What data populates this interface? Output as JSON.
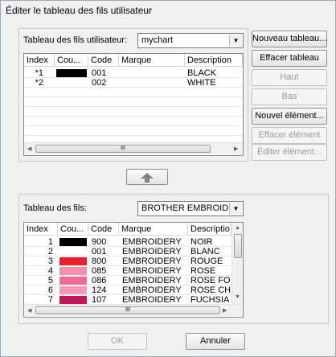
{
  "window": {
    "title": "Éditer le tableau des fils utilisateur"
  },
  "user_panel": {
    "label": "Tableau des fils utilisateur:",
    "chart_value": "mychart",
    "columns": [
      "Index",
      "Cou...",
      "Code",
      "Marque",
      "Description"
    ],
    "rows": [
      {
        "index": "*1",
        "color": "#000000",
        "code": "001",
        "brand": "",
        "description": "BLACK"
      },
      {
        "index": "*2",
        "color": "#ffffff",
        "code": "002",
        "brand": "",
        "description": "WHITE"
      }
    ],
    "scroll_thumb_glyph": "III",
    "buttons": {
      "new_chart": "Nouveau tableau...",
      "delete_chart": "Effacer tableau",
      "up": "Haut",
      "down": "Bas",
      "new_item": "Nouvel élément...",
      "delete_item": "Effacer élément",
      "edit_item": "Éditer élément..."
    }
  },
  "thread_panel": {
    "label": "Tableau des fils:",
    "chart_value": "BROTHER EMBROIDEF",
    "columns": [
      "Index",
      "Cou...",
      "Code",
      "Marque",
      "Descriptio"
    ],
    "rows": [
      {
        "index": "1",
        "color": "#000000",
        "code": "900",
        "brand": "EMBROIDERY",
        "description": "NOIR"
      },
      {
        "index": "2",
        "color": "#ffffff",
        "code": "001",
        "brand": "EMBROIDERY",
        "description": "BLANC"
      },
      {
        "index": "3",
        "color": "#e8202e",
        "code": "800",
        "brand": "EMBROIDERY",
        "description": "ROUGE"
      },
      {
        "index": "4",
        "color": "#f48fb0",
        "code": "085",
        "brand": "EMBROIDERY",
        "description": "ROSE"
      },
      {
        "index": "5",
        "color": "#ef6a96",
        "code": "086",
        "brand": "EMBROIDERY",
        "description": "ROSE FO"
      },
      {
        "index": "6",
        "color": "#f49ab8",
        "code": "124",
        "brand": "EMBROIDERY",
        "description": "ROSE CH"
      },
      {
        "index": "7",
        "color": "#c4145a",
        "code": "107",
        "brand": "EMBROIDERY",
        "description": "FUCHSIA"
      }
    ],
    "scroll_thumb_glyph": "III"
  },
  "footer": {
    "ok": "OK",
    "cancel": "Annuler"
  }
}
